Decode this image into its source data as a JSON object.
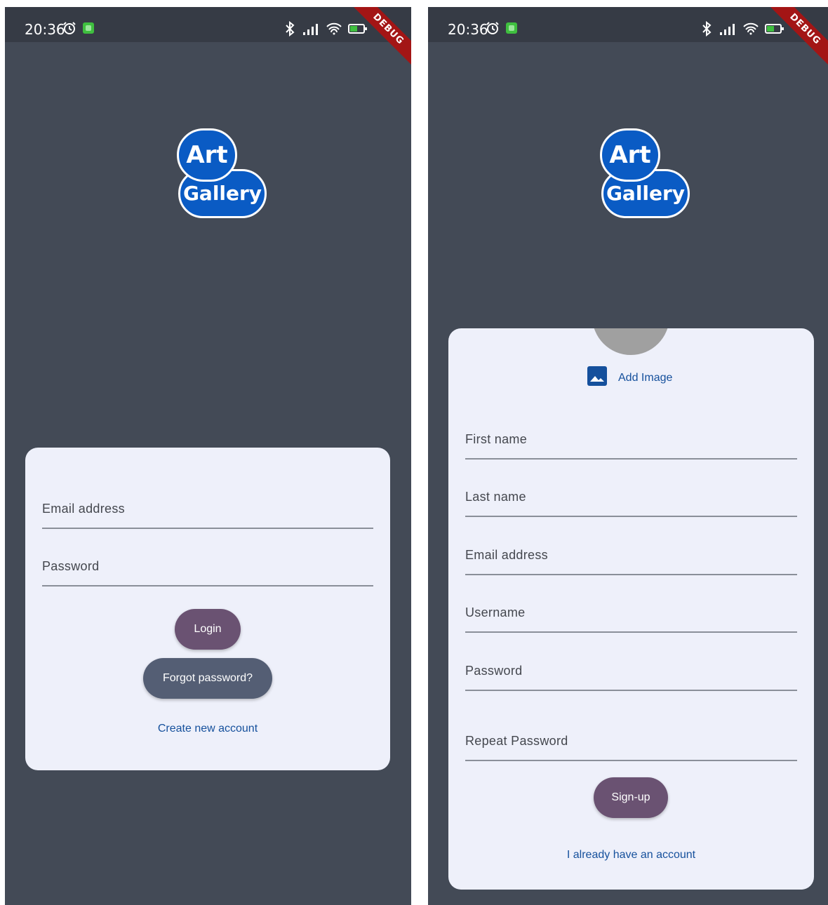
{
  "status": {
    "time": "20:36"
  },
  "debug_label": "DEBUG",
  "logo": {
    "line1": "Art",
    "line2": "Gallery",
    "color": "#0a5bc4"
  },
  "login": {
    "email_label": "Email address",
    "password_label": "Password",
    "login_button": "Login",
    "forgot_button": "Forgot password?",
    "create_link": "Create new account"
  },
  "signup": {
    "add_image": "Add Image",
    "first_name_label": "First name",
    "last_name_label": "Last name",
    "email_label": "Email address",
    "username_label": "Username",
    "password_label": "Password",
    "repeat_password_label": "Repeat Password",
    "signup_button": "Sign-up",
    "have_account_link": "I already have an account"
  },
  "colors": {
    "background": "#434a56",
    "card": "#eef0fa",
    "primary_button": "#6a5272",
    "secondary_button": "#545e74",
    "link": "#15509c"
  }
}
